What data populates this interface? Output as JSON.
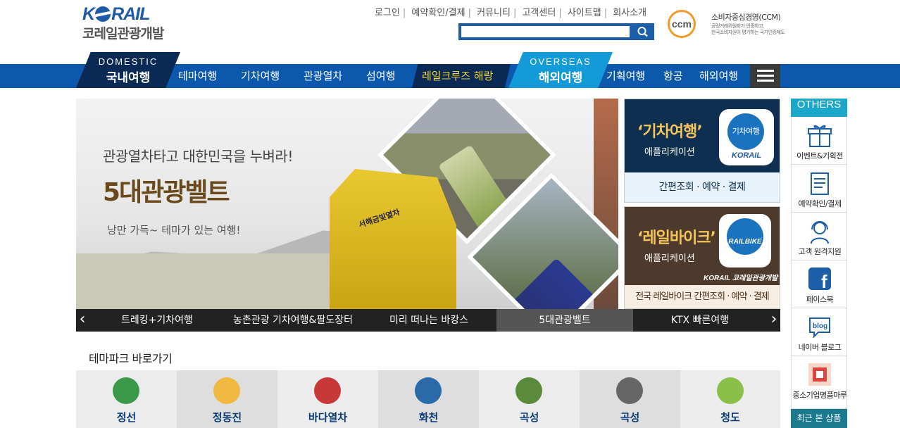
{
  "header": {
    "logo_en": "KORAIL",
    "logo_ko": "코레일관광개발",
    "links": [
      "로그인",
      "예약확인/결제",
      "커뮤니티",
      "고객센터",
      "사이트맵",
      "회사소개"
    ],
    "search_placeholder": "",
    "ccm_circle": "ccm",
    "ccm_title": "소비자중심경영(CCM)",
    "ccm_desc1": "공정거래위원회가 인증하고,",
    "ccm_desc2": "한국소비자원이 평가하는 국가인증제도"
  },
  "nav": {
    "domestic_en": "DOMESTIC",
    "domestic_ko": "국내여행",
    "items_left": [
      "테마여행",
      "기차여행",
      "관광열차",
      "섬여행"
    ],
    "cruise": "레일크루즈 해랑",
    "overseas_en": "OVERSEAS",
    "overseas_ko": "해외여행",
    "items_right": [
      "기획여행",
      "항공",
      "해외여행"
    ]
  },
  "hero": {
    "subtitle": "관광열차타고 대한민국을 누벼라!",
    "title": "5대관광벨트",
    "tagline": "낭만 가득~ 테마가 있는 여행!",
    "train_label": "서해금빛열차"
  },
  "tabs": [
    "트레킹+기차여행",
    "농촌관광 기차여행&팔도장터",
    "미리 떠나는 바캉스",
    "5대관광벨트",
    "KTX 빠른여행"
  ],
  "active_tab": "5대관광벨트",
  "card1": {
    "title": "‘기차여행’",
    "sub": "애플리케이션",
    "icon_label": "기차여행",
    "icon_brand": "KORAIL",
    "bottom": "간편조회 · 예약 · 결제"
  },
  "card2": {
    "title": "‘레일바이크’",
    "sub": "애플리케이션",
    "icon_label": "RAILBIKE",
    "logo": "KORAIL 코레일관광개발",
    "bottom": "전국 레일바이크 간편조회 · 예약 · 결제"
  },
  "others": {
    "header": "OTHERS",
    "items": [
      "이벤트&기획전",
      "예약확인/결제",
      "고객 원격지원",
      "페이스북",
      "네이버 블로그",
      "중소기업명품마루"
    ],
    "recent": "최근 본 상품"
  },
  "themes": {
    "title": "테마파크 바로가기",
    "items": [
      "정선",
      "정동진",
      "바다열차",
      "화천",
      "곡성",
      "곡성",
      "청도"
    ]
  },
  "colors": {
    "nav_blue": "#0b58ad",
    "nav_dark": "#0a2a55",
    "overseas": "#139ad8",
    "cruise_text": "#f6d83a",
    "others_header": "#1aa7c9"
  }
}
